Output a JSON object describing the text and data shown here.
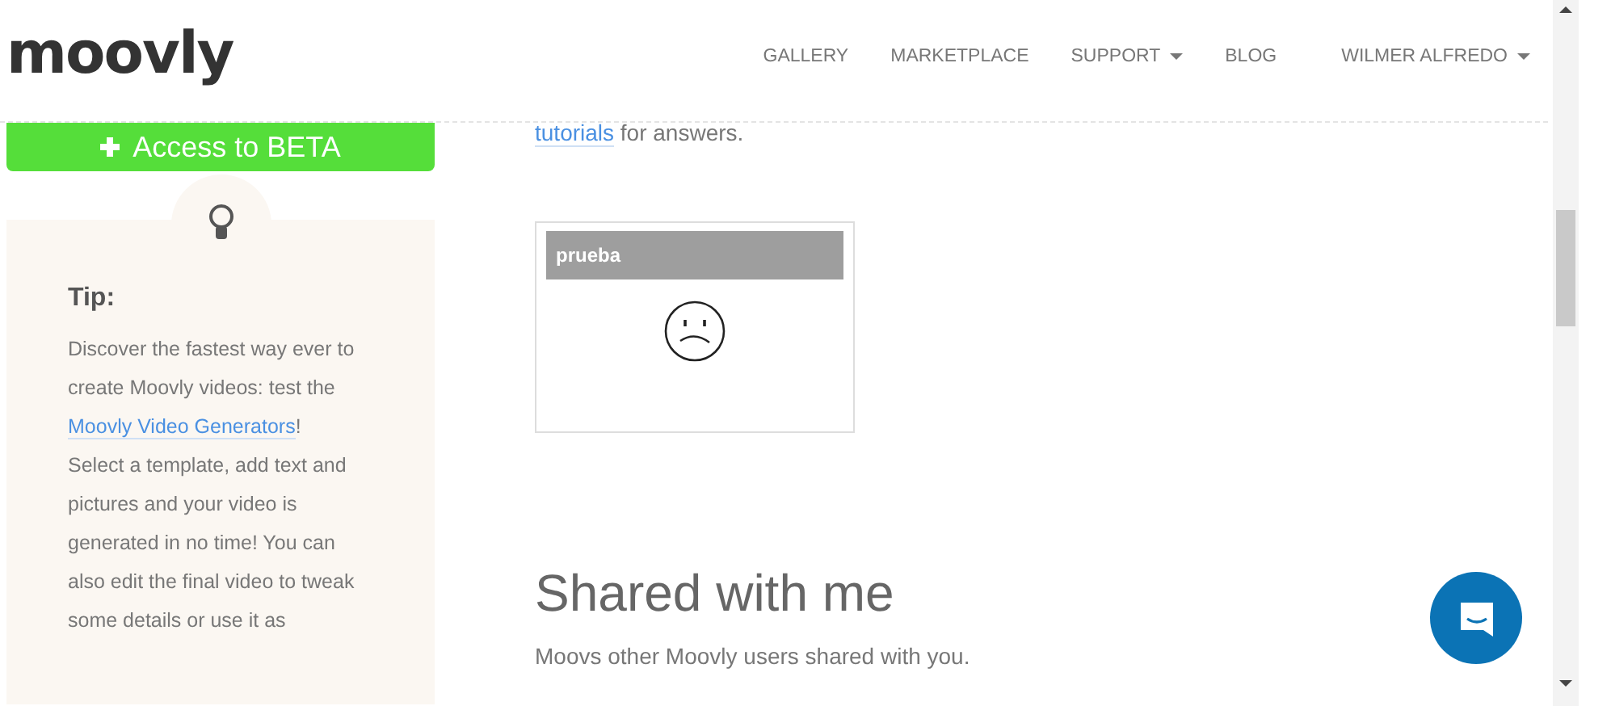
{
  "header": {
    "logo": "moovly",
    "nav": [
      {
        "label": "GALLERY",
        "dropdown": false
      },
      {
        "label": "MARKETPLACE",
        "dropdown": false
      },
      {
        "label": "SUPPORT",
        "dropdown": true
      },
      {
        "label": "BLOG",
        "dropdown": false
      }
    ],
    "user": {
      "label": "WILMER ALFREDO",
      "dropdown": true
    }
  },
  "sidebar": {
    "beta_button": "Access to BETA",
    "tip": {
      "title": "Tip:",
      "text_before": "Discover the fastest way ever to create Moovly videos: test the ",
      "link": "Moovly Video Generators",
      "text_after": "! Select a template, add text and pictures and your video is generated in no time! You can also edit the final video to tweak some details or use it as"
    }
  },
  "main": {
    "intro_link": "tutorials",
    "intro_text": " for answers.",
    "moovs": [
      {
        "title": "prueba"
      }
    ],
    "shared": {
      "heading": "Shared with me",
      "text": "Moovs other Moovly users shared with you."
    }
  }
}
